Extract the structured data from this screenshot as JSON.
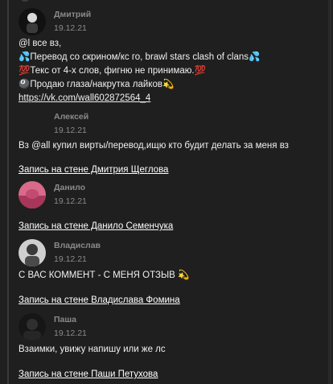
{
  "posts": [
    {
      "author": "Дмитрий",
      "date": "19.12.21",
      "avatar_icon": "avatar-dark-figure",
      "lines": [
        "@l все вз,",
        "💦Перевод со скрином/кс го, brawl stars clash of clans💦",
        "💯Текс от 4-х слов, фигню не принимаю.💯",
        "🎱Продаю глаза/накрутка лайков💫",
        "https://vk.com/wall602872564_4"
      ]
    },
    {
      "author": "Алексей",
      "date": "19.12.21",
      "lines": [
        "Вз @all купил вирты/перевод,ищю кто будит делать за меня вз"
      ],
      "link": "Запись на стене Дмитрия Щеглова"
    },
    {
      "author": "Данило",
      "date": "19.12.21",
      "avatar_icon": "avatar-pink-landscape",
      "lines": [],
      "link": "Запись на стене Данило Семенчука"
    },
    {
      "author": "Владислав",
      "date": "19.12.21",
      "avatar_icon": "avatar-grey-portrait",
      "lines": [
        "С ВАС КОММЕНТ - С МЕНЯ ОТЗЫВ 💫"
      ],
      "link": "Запись на стене Владислава Фомина"
    },
    {
      "author": "Паша",
      "date": "19.12.21",
      "avatar_icon": "avatar-dark-photo",
      "lines": [
        "Взаимки, увижу напишу или же лс"
      ],
      "link": "Запись на стене Паши Петухова"
    }
  ],
  "colors": {
    "background": "#1f1f1f",
    "meta_text": "#8a8a8a",
    "body_text": "#f0f0f0"
  }
}
